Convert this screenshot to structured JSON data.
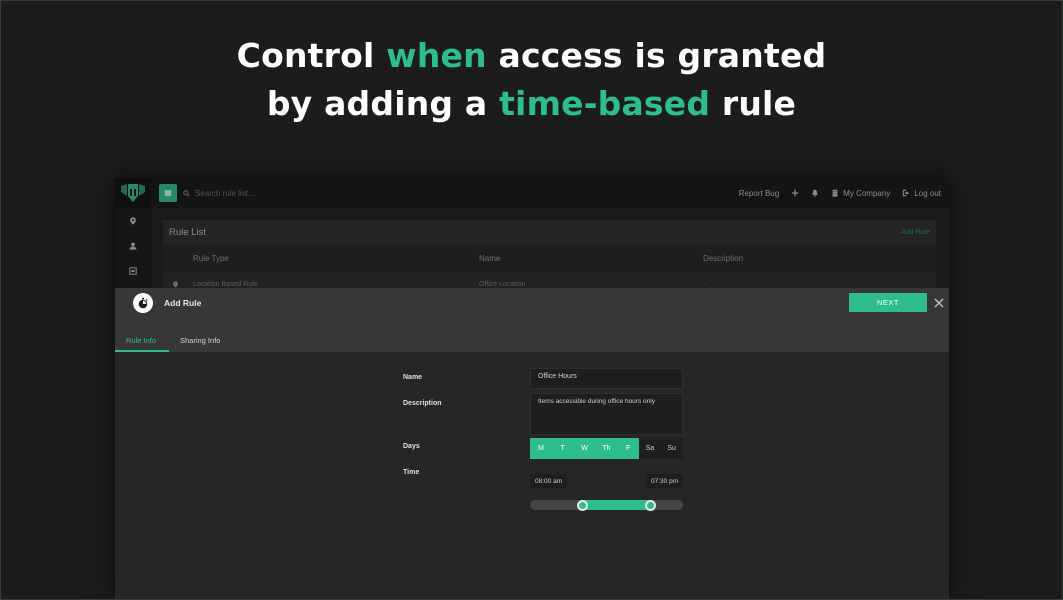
{
  "headline": {
    "line1_part1": "Control ",
    "line1_accent": "when",
    "line1_part2": " access is granted",
    "line2_part1": "by adding a ",
    "line2_accent": "time-based",
    "line2_part2": " rule"
  },
  "colors": {
    "accent": "#2dbe8c",
    "background": "#1c1c1c",
    "modal_header": "#373737"
  },
  "topbar": {
    "menu_icon": "hamburger-icon",
    "search_placeholder": "Search rule list...",
    "report_bug": "Report Bug",
    "add_icon": "plus-icon",
    "notifications_icon": "bell-icon",
    "company": "My Company",
    "logout": "Log out"
  },
  "sidebar": {
    "items": [
      {
        "icon": "location-pin-icon"
      },
      {
        "icon": "user-icon"
      },
      {
        "icon": "calendar-box-icon"
      }
    ]
  },
  "rule_list": {
    "title": "Rule List",
    "add_link": "Add Rule",
    "columns": [
      "Rule Type",
      "Name",
      "Description"
    ],
    "rows": [
      {
        "type": "Location Based Rule",
        "name": "Office Location",
        "description": "-"
      }
    ]
  },
  "modal": {
    "title": "Add Rule",
    "icon": "stopwatch-icon",
    "next_label": "NEXT",
    "close_icon": "close-icon",
    "tabs": [
      {
        "label": "Rule Info",
        "active": true
      },
      {
        "label": "Sharing Info",
        "active": false
      }
    ],
    "form": {
      "name_label": "Name",
      "name_value": "Office Hours",
      "description_label": "Description",
      "description_value": "Items accessible during office hours only",
      "days_label": "Days",
      "days": [
        {
          "label": "M",
          "selected": true
        },
        {
          "label": "T",
          "selected": true
        },
        {
          "label": "W",
          "selected": true
        },
        {
          "label": "Th",
          "selected": true
        },
        {
          "label": "F",
          "selected": true
        },
        {
          "label": "Sa",
          "selected": false
        },
        {
          "label": "Su",
          "selected": false
        }
      ],
      "time_label": "Time",
      "start_time": "08:00 am",
      "end_time": "07:30 pm",
      "range_start_fraction": 0.345,
      "range_end_fraction": 0.79
    }
  }
}
